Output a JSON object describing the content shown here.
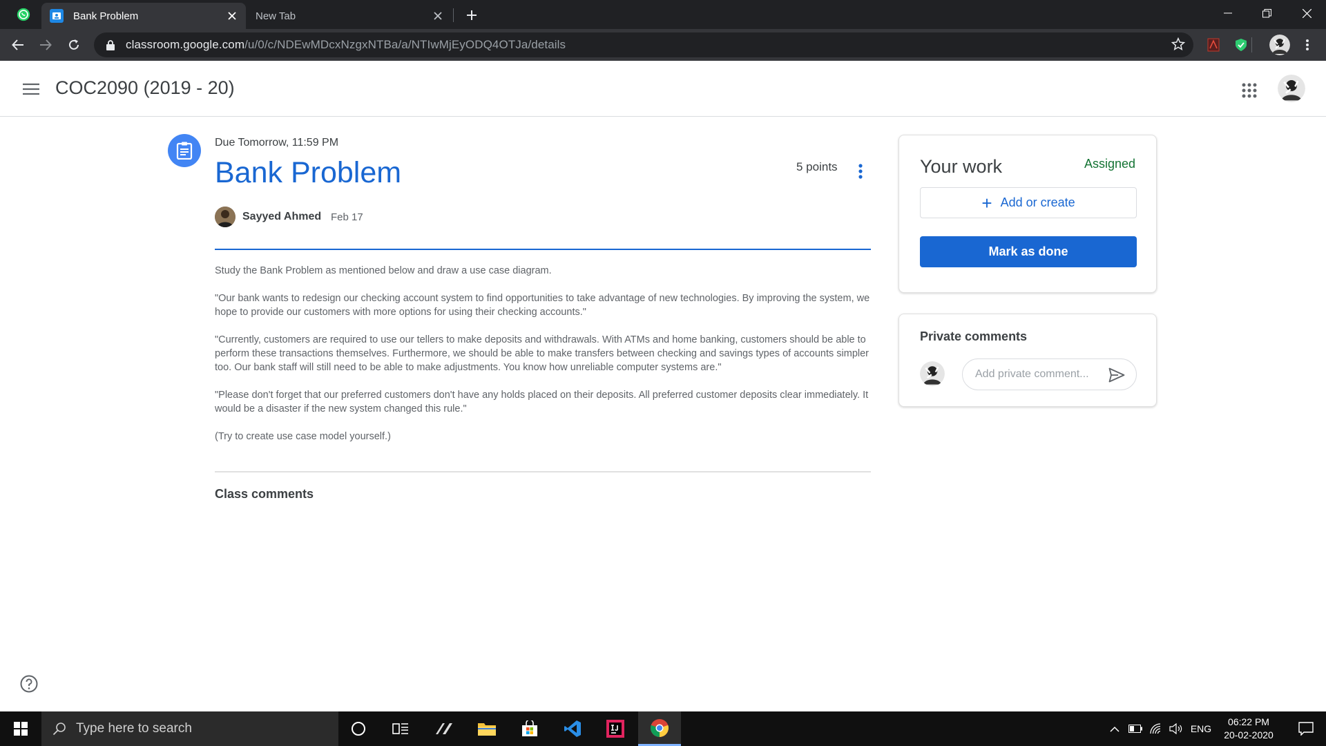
{
  "browser": {
    "tabs": [
      {
        "title": "Bank Problem",
        "active": true
      },
      {
        "title": "New Tab",
        "active": false
      }
    ],
    "url_host": "classroom.google.com",
    "url_path": "/u/0/c/NDEwMDcxNzgxNTBa/a/NTIwMjEyODQ4OTJa/details"
  },
  "header": {
    "class_name": "COC2090 (2019 - 20)"
  },
  "assignment": {
    "due": "Due Tomorrow, 11:59 PM",
    "title": "Bank Problem",
    "points": "5 points",
    "author": "Sayyed Ahmed",
    "posted_date": "Feb 17",
    "paragraphs": [
      "Study the Bank Problem as mentioned below and draw a use case diagram.",
      "\"Our bank wants to redesign our checking account system to find opportunities to take advantage of new technologies. By improving the system, we hope to provide our customers with more options for using their checking accounts.\"",
      "\"Currently, customers are required to use our tellers to make deposits and withdrawals. With ATMs and home banking, customers should be able to perform these transactions themselves. Furthermore, we should be able to make transfers between checking and savings types of accounts simpler too. Our bank staff will still need to be able to make adjustments. You know how unreliable computer systems are.\"",
      "\"Please don't forget that our preferred customers don't have any holds placed on their deposits. All preferred customer deposits clear immediately. It would be a disaster if the new system changed this rule.\"",
      "(Try to create use case model yourself.)"
    ],
    "class_comments_label": "Class comments"
  },
  "your_work": {
    "heading": "Your work",
    "status": "Assigned",
    "add_create_label": "Add or create",
    "mark_done_label": "Mark as done"
  },
  "private_comments": {
    "heading": "Private comments",
    "placeholder": "Add private comment..."
  },
  "taskbar": {
    "search_placeholder": "Type here to search",
    "language": "ENG",
    "time": "06:22 PM",
    "date": "20-02-2020"
  },
  "colors": {
    "accent": "#1967d2",
    "status_assigned": "#137333",
    "chrome_dark": "#202124"
  }
}
